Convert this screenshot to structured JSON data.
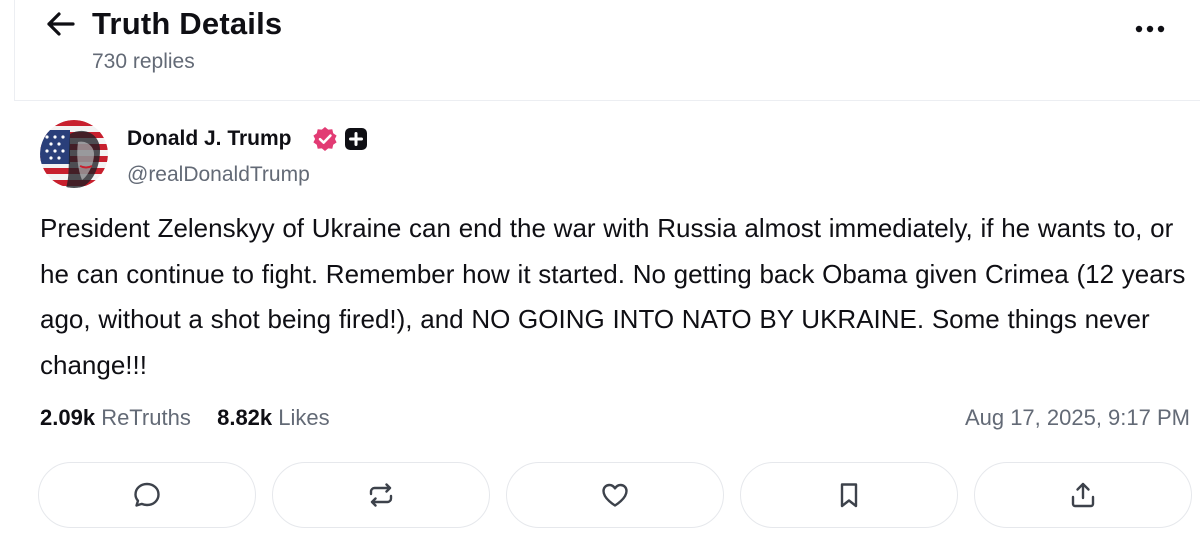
{
  "header": {
    "title": "Truth Details",
    "reply_count": "730 replies",
    "back_icon": "arrow-left-icon",
    "more_icon": "more-horizontal-icon"
  },
  "post": {
    "author": {
      "name": "Donald J. Trump",
      "handle": "@realDonaldTrump",
      "verified_icon": "verified-badge-icon",
      "plus_icon": "plus-badge-icon",
      "verified_color": "#e23b74"
    },
    "text": "President Zelenskyy of Ukraine can end the war with Russia almost immediately, if he wants to, or he can continue to fight. Remember how it started. No getting back Obama given Crimea (12 years ago, without a shot being fired!), and NO GOING INTO NATO BY UKRAINE. Some things never change!!!",
    "stats": {
      "retruths_count": "2.09k",
      "retruths_label": "ReTruths",
      "likes_count": "8.82k",
      "likes_label": "Likes"
    },
    "timestamp": "Aug 17, 2025, 9:17 PM"
  },
  "actions": [
    {
      "icon": "reply-icon"
    },
    {
      "icon": "retruth-icon"
    },
    {
      "icon": "like-heart-icon"
    },
    {
      "icon": "bookmark-icon"
    },
    {
      "icon": "share-icon"
    }
  ],
  "colors": {
    "text_primary": "#0f0f14",
    "text_secondary": "#636a76",
    "border": "#e6e8ec",
    "badge_pink": "#e23b74"
  }
}
